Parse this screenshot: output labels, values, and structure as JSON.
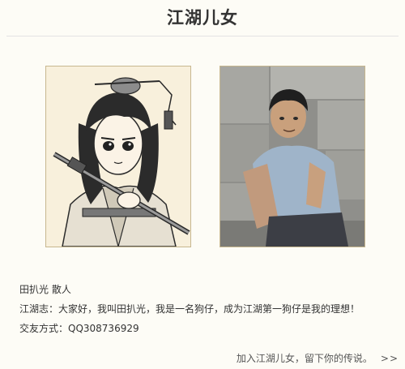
{
  "page": {
    "title": "江湖儿女"
  },
  "images": {
    "cartoon": {
      "name": "cartoon-portrait"
    },
    "real": {
      "name": "real-photo"
    }
  },
  "profile": {
    "name_line": "田扒光 散人",
    "motto_line": "江湖志：大家好，我叫田扒光，我是一名狗仔，成为江湖第一狗仔是我的理想！",
    "contact_line": "交友方式：QQ308736929"
  },
  "footer": {
    "join_link": "加入江湖儿女，留下你的传说。",
    "arrows": ">>"
  },
  "colors": {
    "background": "#fdfcf6",
    "frame_border": "#c7b78f",
    "title_text": "#333333"
  }
}
